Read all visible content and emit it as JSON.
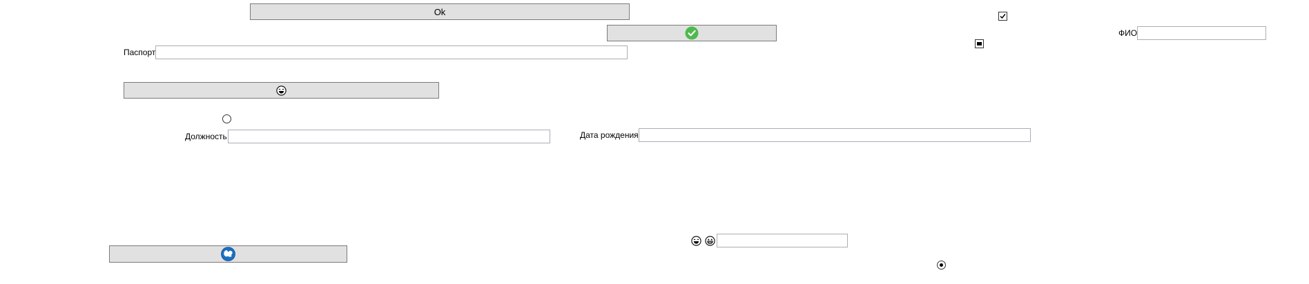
{
  "buttons": {
    "ok_label": "Ok",
    "check_icon": "check-circle-icon",
    "laugh_icon": "laughing-face-icon",
    "globe_icon": "blue-globe-icon"
  },
  "fields": {
    "fio_label": "ФИО",
    "fio_value": "",
    "passport_label": "Паспорт",
    "passport_value": "",
    "position_label": "Должность",
    "position_value": "",
    "birthdate_label": "Дата рождения",
    "birthdate_value": "",
    "emoji_field_value": ""
  },
  "toggles": {
    "checkbox_checked": true,
    "checkbox_indeterminate": true,
    "radio_unselected": false,
    "radio_selected": true
  },
  "emoji_icons": [
    "laughing-face-icon",
    "grinning-face-icon"
  ],
  "colors": {
    "button_bg": "#e1e1e1",
    "check_green": "#4cba4c",
    "globe_blue": "#1b6fc1"
  }
}
